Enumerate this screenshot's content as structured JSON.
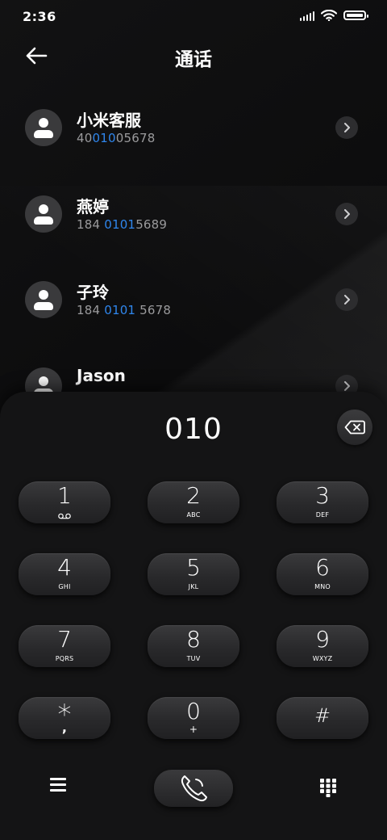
{
  "status_bar": {
    "time": "2:36"
  },
  "header": {
    "title": "通话"
  },
  "contacts": [
    {
      "name": "小米客服",
      "num_pre": "40",
      "num_hl": "010",
      "num_post": "05678"
    },
    {
      "name": "燕婷",
      "num_pre": "184 ",
      "num_hl": "0101",
      "num_post": "5689"
    },
    {
      "name": "子玲",
      "num_pre": "184 ",
      "num_hl": "0101",
      "num_post": " 5678"
    },
    {
      "name": "Jason",
      "num_pre": "",
      "num_hl": "",
      "num_post": ""
    }
  ],
  "dialer": {
    "display": "010",
    "keys": [
      {
        "digit": "1",
        "letters": ""
      },
      {
        "digit": "2",
        "letters": "ABC"
      },
      {
        "digit": "3",
        "letters": "DEF"
      },
      {
        "digit": "4",
        "letters": "GHI"
      },
      {
        "digit": "5",
        "letters": "JKL"
      },
      {
        "digit": "6",
        "letters": "MNO"
      },
      {
        "digit": "7",
        "letters": "PQRS"
      },
      {
        "digit": "8",
        "letters": "TUV"
      },
      {
        "digit": "9",
        "letters": "WXYZ"
      },
      {
        "digit": "*",
        "letters": ","
      },
      {
        "digit": "0",
        "letters": "+"
      },
      {
        "digit": "#",
        "letters": ""
      }
    ]
  },
  "icons": {
    "back": "arrow-left-icon",
    "voicemail": "voicemail-icon",
    "delete": "backspace-icon",
    "call": "phone-icon",
    "menu": "menu-icon",
    "keypad": "keypad-icon"
  },
  "colors": {
    "highlight": "#2f86ec",
    "background": "#0b0b0c",
    "panel": "#141415"
  }
}
